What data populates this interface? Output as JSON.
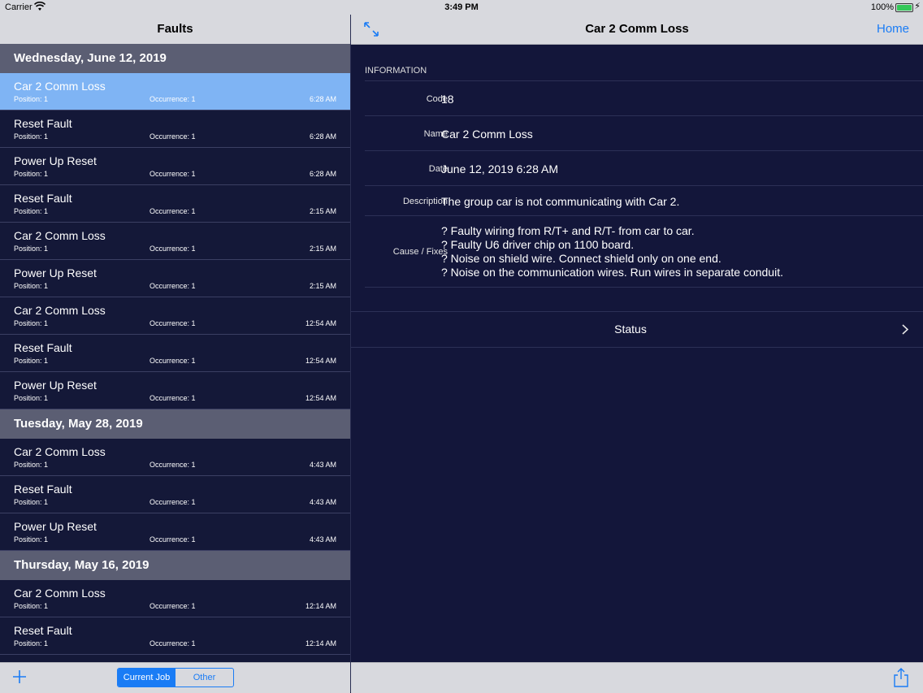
{
  "status_bar": {
    "carrier": "Carrier",
    "time": "3:49 PM",
    "battery": "100%"
  },
  "master": {
    "title": "Faults",
    "sections": [
      {
        "header": "Wednesday, June 12, 2019",
        "rows": [
          {
            "name": "Car 2 Comm Loss",
            "position": "Position: 1",
            "occurrence": "Occurrence: 1",
            "time": "6:28 AM",
            "selected": true
          },
          {
            "name": "Reset Fault",
            "position": "Position: 1",
            "occurrence": "Occurrence: 1",
            "time": "6:28 AM"
          },
          {
            "name": "Power Up Reset",
            "position": "Position: 1",
            "occurrence": "Occurrence: 1",
            "time": "6:28 AM"
          },
          {
            "name": "Reset Fault",
            "position": "Position: 1",
            "occurrence": "Occurrence: 1",
            "time": "2:15 AM"
          },
          {
            "name": "Car 2 Comm Loss",
            "position": "Position: 1",
            "occurrence": "Occurrence: 1",
            "time": "2:15 AM"
          },
          {
            "name": "Power Up Reset",
            "position": "Position: 1",
            "occurrence": "Occurrence: 1",
            "time": "2:15 AM"
          },
          {
            "name": "Car 2 Comm Loss",
            "position": "Position: 1",
            "occurrence": "Occurrence: 1",
            "time": "12:54 AM"
          },
          {
            "name": "Reset Fault",
            "position": "Position: 1",
            "occurrence": "Occurrence: 1",
            "time": "12:54 AM"
          },
          {
            "name": "Power Up Reset",
            "position": "Position: 1",
            "occurrence": "Occurrence: 1",
            "time": "12:54 AM"
          }
        ]
      },
      {
        "header": "Tuesday, May 28, 2019",
        "rows": [
          {
            "name": "Car 2 Comm Loss",
            "position": "Position: 1",
            "occurrence": "Occurrence: 1",
            "time": "4:43 AM"
          },
          {
            "name": "Reset Fault",
            "position": "Position: 1",
            "occurrence": "Occurrence: 1",
            "time": "4:43 AM"
          },
          {
            "name": "Power Up Reset",
            "position": "Position: 1",
            "occurrence": "Occurrence: 1",
            "time": "4:43 AM"
          }
        ]
      },
      {
        "header": "Thursday, May 16, 2019",
        "rows": [
          {
            "name": "Car 2 Comm Loss",
            "position": "Position: 1",
            "occurrence": "Occurrence: 1",
            "time": "12:14 AM"
          },
          {
            "name": "Reset Fault",
            "position": "Position: 1",
            "occurrence": "Occurrence: 1",
            "time": "12:14 AM"
          }
        ]
      }
    ],
    "toolbar": {
      "segments": [
        "Current Job",
        "Other"
      ],
      "selected_segment": "Current Job"
    }
  },
  "detail": {
    "title": "Car 2 Comm Loss",
    "home_label": "Home",
    "section_title": "INFORMATION",
    "fields": {
      "code": {
        "label": "Code",
        "value": "18"
      },
      "name": {
        "label": "Name",
        "value": "Car 2 Comm Loss"
      },
      "date": {
        "label": "Date",
        "value": "June 12, 2019 6:28 AM"
      },
      "description": {
        "label": "Description",
        "value": "The group car is not communicating with Car 2."
      },
      "cause": {
        "label": "Cause / Fixes",
        "lines": [
          "? Faulty wiring from R/T+ and R/T- from car to car.",
          "? Faulty U6 driver chip on 1100 board.",
          "? Noise on shield wire. Connect shield only on one end.",
          "? Noise on the communication wires. Run wires in separate conduit."
        ]
      }
    },
    "status_label": "Status"
  },
  "colors": {
    "accent": "#1a7cf5",
    "selected_row": "#7fb4f4",
    "section_header": "#5b5e73",
    "background": "#13163a",
    "bar": "#d8d9de"
  }
}
